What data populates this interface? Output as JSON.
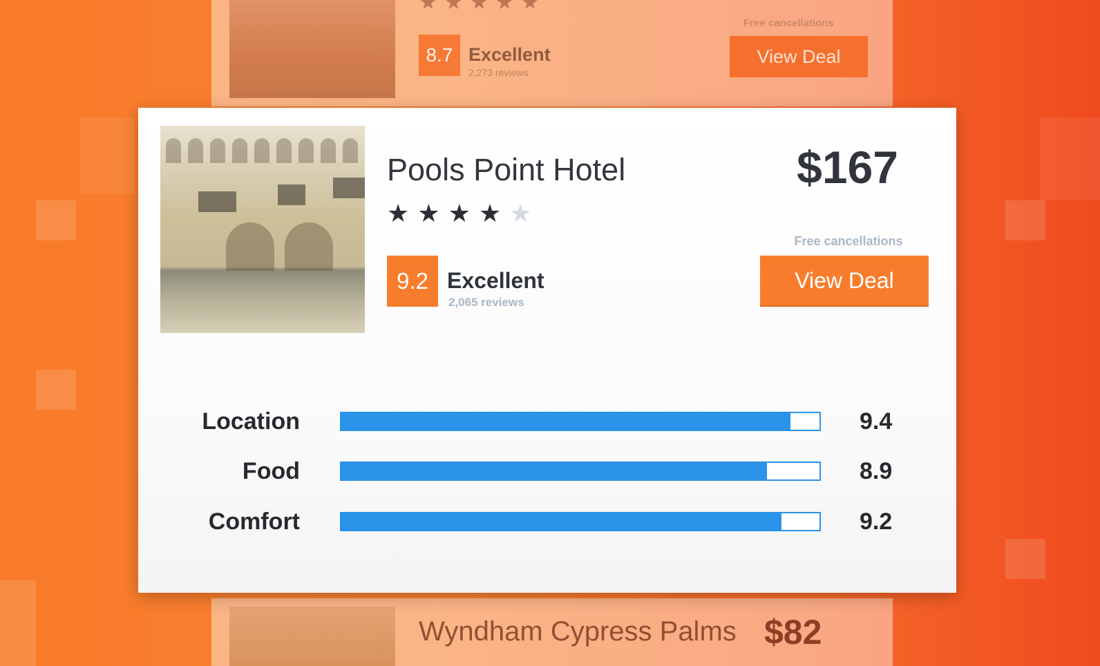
{
  "background_card_top": {
    "stars_filled": 4,
    "stars_total": 5,
    "score": "8.7",
    "score_label": "Excellent",
    "reviews": "2,273 reviews",
    "cancellation": "Free cancellations",
    "deal_label": "View Deal"
  },
  "background_card_bottom": {
    "name": "Wyndham Cypress Palms",
    "price": "$82"
  },
  "hotel": {
    "name": "Pools Point Hotel",
    "stars_filled": 4,
    "stars_total": 5,
    "score": "9.2",
    "score_label": "Excellent",
    "reviews": "2,065 reviews",
    "price": "$167",
    "cancellation": "Free cancellations",
    "deal_label": "View Deal"
  },
  "ratings": [
    {
      "label": "Location",
      "value": "9.4",
      "fraction": 0.94
    },
    {
      "label": "Food",
      "value": "8.9",
      "fraction": 0.89
    },
    {
      "label": "Comfort",
      "value": "9.2",
      "fraction": 0.92
    }
  ],
  "colors": {
    "accent_orange": "#f77d2d",
    "bar_blue": "#2a92e8"
  }
}
